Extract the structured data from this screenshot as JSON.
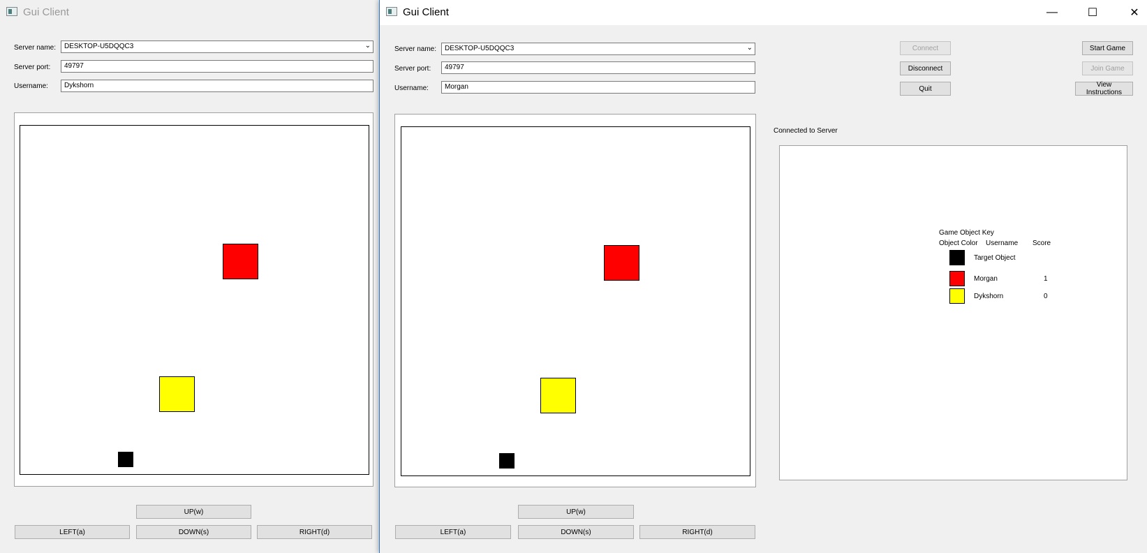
{
  "windows": [
    {
      "id": "back",
      "title": "Gui Client",
      "server_name_label": "Server name:",
      "server_name": "DESKTOP-U5DQQC3",
      "server_port_label": "Server port:",
      "server_port": "49797",
      "username_label": "Username:",
      "username": "Dykshorn",
      "controls": {
        "up": "UP(w)",
        "left": "LEFT(a)",
        "down": "DOWN(s)",
        "right": "RIGHT(d)"
      }
    },
    {
      "id": "front",
      "title": "Gui Client",
      "server_name_label": "Server name:",
      "server_name": "DESKTOP-U5DQQC3",
      "server_port_label": "Server port:",
      "server_port": "49797",
      "username_label": "Username:",
      "username": "Morgan",
      "buttons": {
        "connect": "Connect",
        "disconnect": "Disconnect",
        "quit": "Quit",
        "start_game": "Start Game",
        "join_game": "Join Game",
        "view_instructions": "View Instructions"
      },
      "status": "Connected to Server",
      "key": {
        "title": "Game Object Key",
        "col_color": "Object Color",
        "col_username": "Username",
        "col_score": "Score",
        "rows": [
          {
            "color": "#000000",
            "name": "Target Object",
            "score": ""
          },
          {
            "color": "#ff0000",
            "name": "Morgan",
            "score": "1"
          },
          {
            "color": "#ffff00",
            "name": "Dykshorn",
            "score": "0"
          }
        ]
      },
      "controls": {
        "up": "UP(w)",
        "left": "LEFT(a)",
        "down": "DOWN(s)",
        "right": "RIGHT(d)"
      }
    }
  ],
  "game_objects": {
    "red_player_color": "#ff0000",
    "yellow_player_color": "#ffff00",
    "target_color": "#000000"
  }
}
